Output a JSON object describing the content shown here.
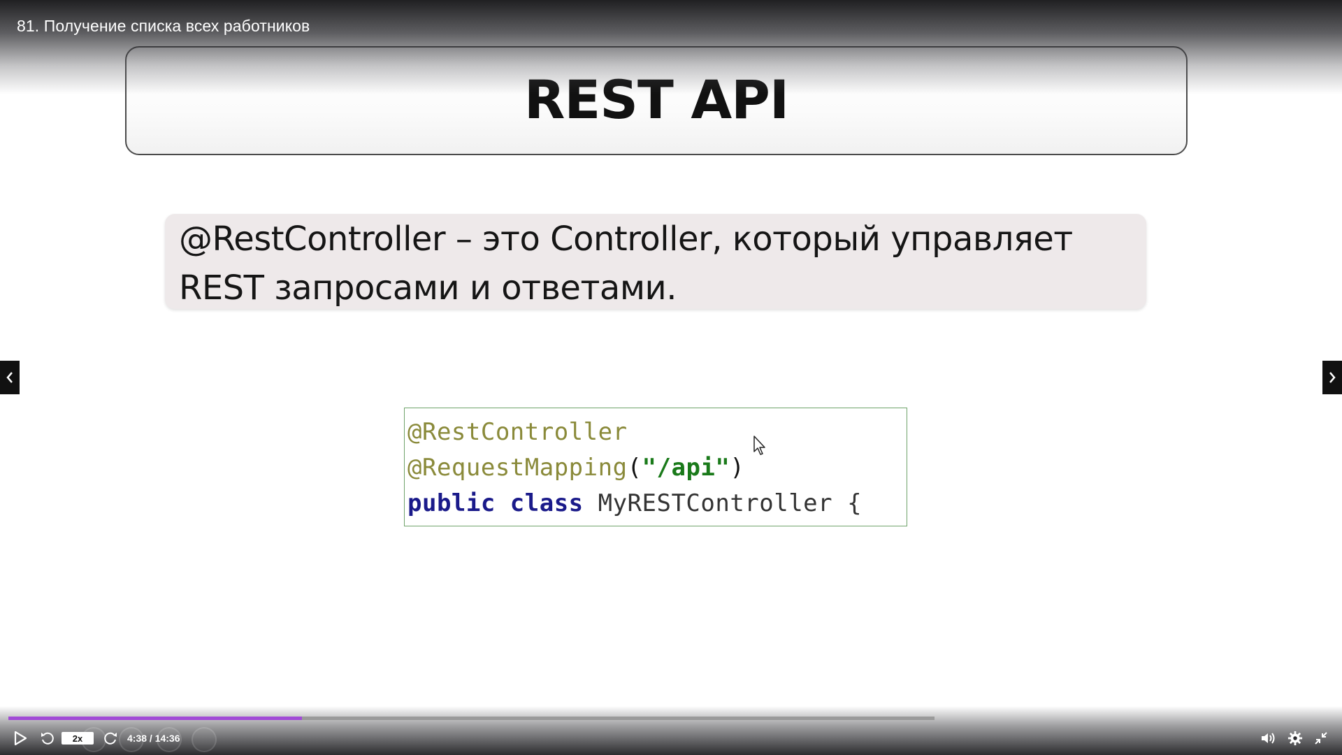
{
  "header": {
    "video_title": "81. Получение списка всех работников"
  },
  "slide": {
    "title": "REST API",
    "description_line1": "@RestController – это Controller, который управляет",
    "description_line2": "REST запросами и ответами.",
    "code": {
      "line1_annotation": "@RestController",
      "line2_annotation": "@RequestMapping",
      "line2_open": "(",
      "line2_string": "\"/api\"",
      "line2_close": ")",
      "line3_keywords": "public class",
      "line3_rest": " MyRESTController {"
    }
  },
  "player": {
    "speed_label": "2x",
    "time_display": "4:38 / 14:36",
    "progress_fraction": 0.3172,
    "buffered_fraction": 1.0,
    "accent_color": "#a14bd6",
    "icons": {
      "play": "play-icon",
      "rewind": "rewind-icon",
      "forward": "forward-icon",
      "volume": "volume-icon",
      "settings": "gear-icon",
      "exit_fullscreen": "exit-fullscreen-icon",
      "prev": "chevron-left-icon",
      "next": "chevron-right-icon"
    }
  }
}
